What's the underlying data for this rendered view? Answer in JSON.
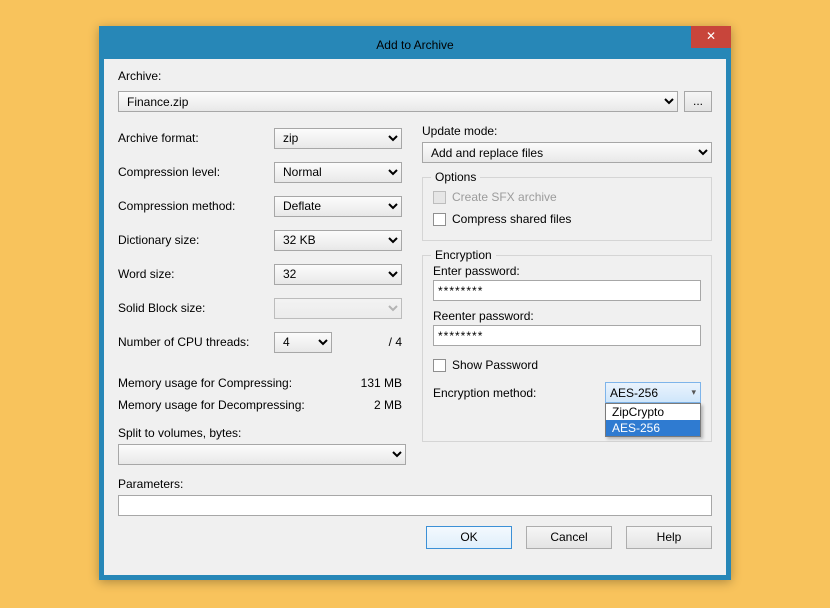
{
  "window": {
    "title": "Add to Archive",
    "close": "✕"
  },
  "archive": {
    "label": "Archive:",
    "value": "Finance.zip",
    "browse": "..."
  },
  "left": {
    "format_label": "Archive format:",
    "format_value": "zip",
    "level_label": "Compression level:",
    "level_value": "Normal",
    "method_label": "Compression method:",
    "method_value": "Deflate",
    "dict_label": "Dictionary size:",
    "dict_value": "32 KB",
    "word_label": "Word size:",
    "word_value": "32",
    "solid_label": "Solid Block size:",
    "solid_value": "",
    "threads_label": "Number of CPU threads:",
    "threads_value": "4",
    "threads_suffix": "/ 4",
    "mem_comp_label": "Memory usage for Compressing:",
    "mem_comp_value": "131 MB",
    "mem_decomp_label": "Memory usage for Decompressing:",
    "mem_decomp_value": "2 MB",
    "split_label": "Split to volumes, bytes:",
    "split_value": ""
  },
  "right": {
    "update_label": "Update mode:",
    "update_value": "Add and replace files",
    "options_legend": "Options",
    "sfx_label": "Create SFX archive",
    "shared_label": "Compress shared files",
    "enc_legend": "Encryption",
    "enter_pw_label": "Enter password:",
    "enter_pw_value": "********",
    "reenter_pw_label": "Reenter password:",
    "reenter_pw_value": "********",
    "show_pw_label": "Show Password",
    "enc_method_label": "Encryption method:",
    "enc_method_value": "AES-256",
    "enc_options": {
      "opt0": "ZipCrypto",
      "opt1": "AES-256"
    }
  },
  "params": {
    "label": "Parameters:",
    "value": ""
  },
  "buttons": {
    "ok": "OK",
    "cancel": "Cancel",
    "help": "Help"
  }
}
